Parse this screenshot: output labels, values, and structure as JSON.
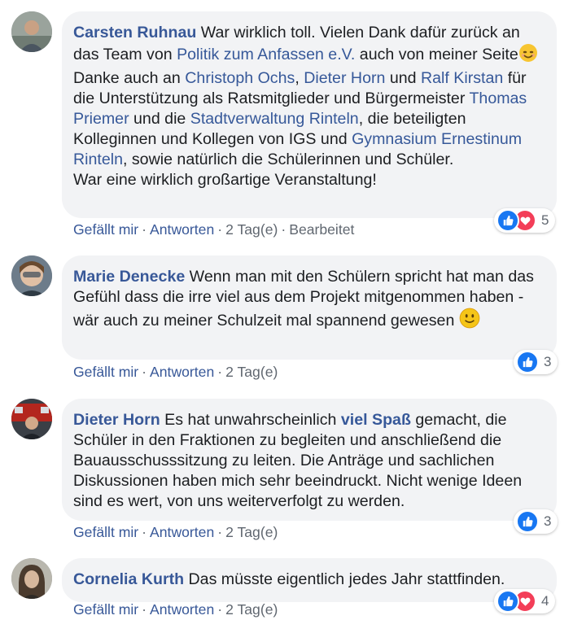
{
  "comments": [
    {
      "author": "Carsten Ruhnau",
      "text_1": " War wirklich toll. Vielen Dank dafür zurück an das Team von ",
      "mention_1": "Politik zum Anfassen e.V.",
      "text_2": " auch von meiner Seite",
      "text_3": " Danke auch an ",
      "mention_2": "Christoph Ochs",
      "text_4": ", ",
      "mention_3": "Dieter Horn",
      "text_5": " und ",
      "mention_4": "Ralf Kirstan",
      "text_6": " für die Unterstützung als Ratsmitglieder und Bürgermeister ",
      "mention_5": "Thomas Priemer",
      "text_7": " und die ",
      "mention_6": "Stadtverwaltung Rinteln",
      "text_8": ", die beteiligten Kolleginnen und Kollegen von IGS und ",
      "mention_7": "Gymnasium Ernestinum Rinteln",
      "text_9": ", sowie natürlich die Schülerinnen und Schüler.",
      "text_10": "War eine wirklich großartige Veranstaltung!",
      "like_label": "Gefällt mir",
      "reply_label": "Antworten",
      "time": "2 Tag(e)",
      "edited": "Bearbeitet",
      "reaction_count": "5",
      "reactions": [
        "like",
        "love"
      ]
    },
    {
      "author": "Marie Denecke",
      "text_1": " Wenn man mit den Schülern spricht hat man das Gefühl dass die irre viel aus dem Projekt mitgenommen haben - wär auch zu meiner Schulzeit mal spannend gewesen ",
      "like_label": "Gefällt mir",
      "reply_label": "Antworten",
      "time": "2 Tag(e)",
      "reaction_count": "3",
      "reactions": [
        "like"
      ]
    },
    {
      "author": "Dieter Horn",
      "text_1": " Es hat unwahrscheinlich ",
      "mention_1": "viel Spaß",
      "text_2": " gemacht, die Schüler in den Fraktionen zu begleiten und anschließend die Bauausschusssitzung zu leiten. Die Anträge und sachlichen Diskussionen haben mich sehr beeindruckt. Nicht wenige Ideen sind es wert, von uns weiterverfolgt zu werden.",
      "like_label": "Gefällt mir",
      "reply_label": "Antworten",
      "time": "2 Tag(e)",
      "reaction_count": "3",
      "reactions": [
        "like"
      ]
    },
    {
      "author": "Cornelia Kurth",
      "text_1": " Das müsste eigentlich jedes Jahr stattfinden.",
      "like_label": "Gefällt mir",
      "reply_label": "Antworten",
      "time": "2 Tag(e)",
      "reaction_count": "4",
      "reactions": [
        "like",
        "love"
      ]
    }
  ],
  "separator": "·",
  "icons": {
    "like": "thumbs-up-icon",
    "love": "heart-icon",
    "smile": "smiling-face-emoji",
    "slight_smile": "slightly-smiling-face-emoji"
  },
  "colors": {
    "author": "#385898",
    "mention": "#365899",
    "bubble": "#f2f3f5",
    "meta": "#606770",
    "like": "#1877f2",
    "love": "#f33e58"
  }
}
